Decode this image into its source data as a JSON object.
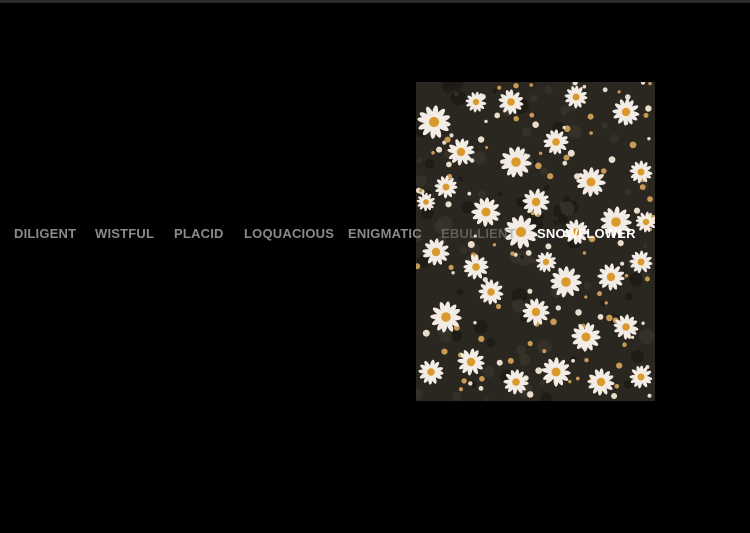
{
  "menu": {
    "items": [
      {
        "label": "DILIGENT",
        "state": "normal"
      },
      {
        "label": "WISTFUL",
        "state": "normal"
      },
      {
        "label": "PLACID",
        "state": "normal"
      },
      {
        "label": "LOQUACIOUS",
        "state": "normal"
      },
      {
        "label": "ENIGMATIC",
        "state": "normal"
      },
      {
        "label": "EBULLIENT",
        "state": "faded"
      },
      {
        "label": "SNOWFLOWER",
        "state": "active"
      }
    ]
  },
  "colors": {
    "background": "#000000",
    "menu_text": "#8a8a8a",
    "menu_active": "#ffffff",
    "photo_bg": "#2a2620",
    "petal": "#f2ece4",
    "flower_center": "#d99a2b"
  },
  "photo": {
    "subject": "daisy-flowers-photo"
  }
}
